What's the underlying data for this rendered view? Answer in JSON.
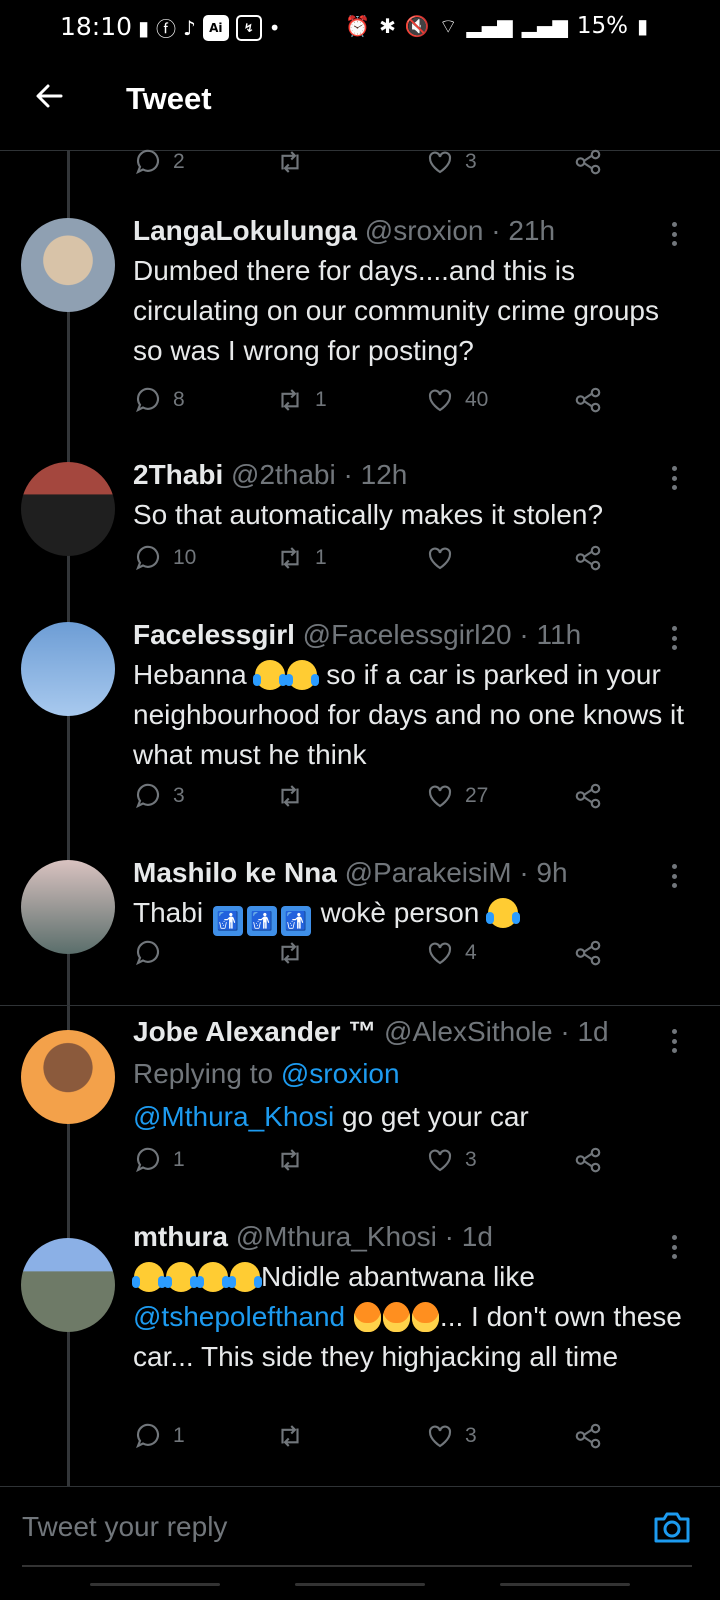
{
  "status_bar": {
    "time": "18:10",
    "notification_icons": [
      "calendar-icon",
      "facebook-icon",
      "tiktok-icon",
      "ai-icon",
      "messenger-icon",
      "dot-icon"
    ],
    "system_icons": [
      "alarm-icon",
      "bluetooth-icon",
      "mute-icon",
      "wifi-icon",
      "signal-icon",
      "signal-icon",
      "battery-icon"
    ],
    "battery": "15%"
  },
  "header": {
    "title": "Tweet"
  },
  "top_actions": {
    "replies": "2",
    "retweets": "",
    "likes": "3"
  },
  "tweets": [
    {
      "name": "LangaLokulunga",
      "handle": "@sroxion",
      "dot": "·",
      "time": "21h",
      "text": "Dumbed there for days....and this is circulating on our community crime groups so was I wrong for posting?",
      "replies": "8",
      "retweets": "1",
      "likes": "40"
    },
    {
      "name": "2Thabi",
      "handle": "@2thabi",
      "dot": "·",
      "time": "12h",
      "text": "So that automatically makes it stolen?",
      "replies": "10",
      "retweets": "1",
      "likes": ""
    },
    {
      "name": "Facelessgirl",
      "handle": "@Facelessgirl20",
      "dot": "·",
      "time": "11h",
      "text_a": "Hebanna",
      "text_b": "so if a car is parked in your neighbourhood for days and no one knows it what must he think",
      "replies": "3",
      "retweets": "",
      "likes": "27"
    },
    {
      "name": "Mashilo ke Nna",
      "handle": "@ParakeisiM",
      "dot": "·",
      "time": "9h",
      "text_a": "Thabi",
      "text_b": "wokè person",
      "replies": "",
      "retweets": "",
      "likes": "4"
    },
    {
      "name": "Jobe Alexander ™",
      "handle": "@AlexSithole",
      "dot": "·",
      "time": "1d",
      "replying_prefix": "Replying to",
      "replying_handle": "@sroxion",
      "mention": "@Mthura_Khosi",
      "text": "go get your car",
      "replies": "1",
      "retweets": "",
      "likes": "3"
    },
    {
      "name": "mthura",
      "handle": "@Mthura_Khosi",
      "dot": "·",
      "time": "1d",
      "text_a": "Ndidle abantwana like",
      "mention": "@tshepolefthand",
      "text_b": "... I don't own these car... This side they highjacking all time",
      "replies": "1",
      "retweets": "",
      "likes": "3"
    }
  ],
  "reply_bar": {
    "placeholder": "Tweet your reply"
  },
  "colors": {
    "background": "#000000",
    "link": "#1d9bf0",
    "muted": "#71767b"
  }
}
